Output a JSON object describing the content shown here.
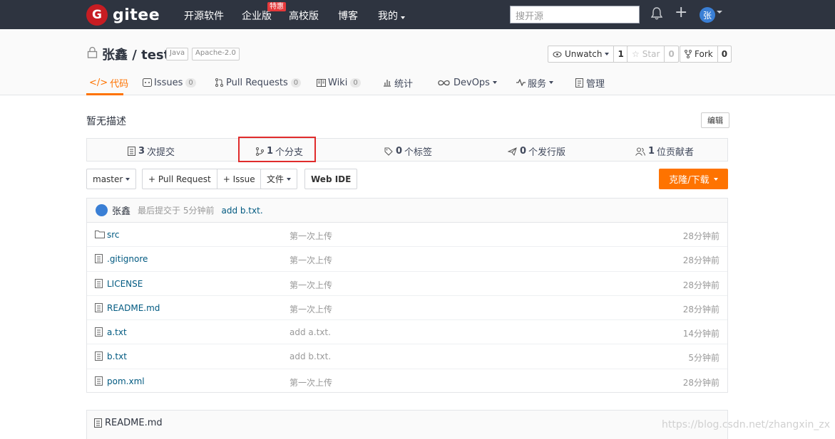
{
  "nav": {
    "logo_letter": "G",
    "logo_text": "gitee",
    "links": [
      "开源软件",
      "企业版",
      "高校版",
      "博客",
      "我的"
    ],
    "badge": "特惠",
    "search_placeholder": "搜开源",
    "avatar_char": "张"
  },
  "project": {
    "title": "张鑫 / test",
    "tags": [
      "Java",
      "Apache-2.0"
    ],
    "watch_label": "Unwatch",
    "watch_count": "1",
    "star_label": "Star",
    "star_count": "0",
    "fork_label": "Fork",
    "fork_count": "0",
    "tabs": [
      {
        "label": "代码",
        "count": ""
      },
      {
        "label": "Issues",
        "count": "0"
      },
      {
        "label": "Pull Requests",
        "count": "0"
      },
      {
        "label": "Wiki",
        "count": "0"
      },
      {
        "label": "统计",
        "count": ""
      },
      {
        "label": "DevOps",
        "count": ""
      },
      {
        "label": "服务",
        "count": ""
      },
      {
        "label": "管理",
        "count": ""
      }
    ]
  },
  "description": {
    "text": "暂无描述",
    "edit_label": "编辑"
  },
  "stats": [
    {
      "count": "3",
      "label": "次提交"
    },
    {
      "count": "1",
      "label": "个分支"
    },
    {
      "count": "0",
      "label": "个标签"
    },
    {
      "count": "0",
      "label": "个发行版"
    },
    {
      "count": "1",
      "label": "位贡献者"
    }
  ],
  "actions": {
    "branch": "master",
    "pull_request": "+ Pull Request",
    "issue": "+ Issue",
    "file": "文件",
    "web_ide": "Web IDE",
    "clone": "克隆/下载"
  },
  "commit": {
    "author": "张鑫",
    "meta": "最后提交于 5分钟前",
    "message": "add b.txt."
  },
  "files": [
    {
      "name": "src",
      "type": "folder",
      "msg": "第一次上传",
      "time": "28分钟前"
    },
    {
      "name": ".gitignore",
      "type": "file",
      "msg": "第一次上传",
      "time": "28分钟前"
    },
    {
      "name": "LICENSE",
      "type": "file",
      "msg": "第一次上传",
      "time": "28分钟前"
    },
    {
      "name": "README.md",
      "type": "file",
      "msg": "第一次上传",
      "time": "28分钟前"
    },
    {
      "name": "a.txt",
      "type": "file",
      "msg": "add a.txt.",
      "time": "14分钟前"
    },
    {
      "name": "b.txt",
      "type": "file",
      "msg": "add b.txt.",
      "time": "5分钟前"
    },
    {
      "name": "pom.xml",
      "type": "file",
      "msg": "第一次上传",
      "time": "28分钟前"
    }
  ],
  "readme": {
    "title": "README.md"
  },
  "watermark": "https://blog.csdn.net/zhangxin_zx"
}
